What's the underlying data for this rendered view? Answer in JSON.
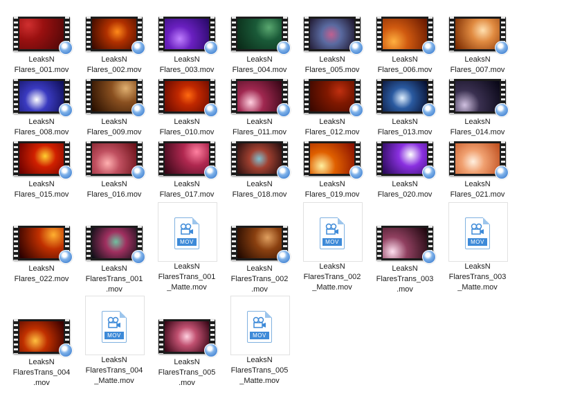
{
  "files": [
    {
      "line1": "LeaksN",
      "line2": "Flares_001.mov",
      "type": "video",
      "c1": "#d03030",
      "c2": "#500808",
      "c3": "#9a1010"
    },
    {
      "line1": "LeaksN",
      "line2": "Flares_002.mov",
      "type": "video",
      "c1": "#ff8a1a",
      "c2": "#3a0a00",
      "c3": "#b03000"
    },
    {
      "line1": "LeaksN",
      "line2": "Flares_003.mov",
      "type": "video",
      "c1": "#c080ff",
      "c2": "#2a0a6a",
      "c3": "#6a20c0"
    },
    {
      "line1": "LeaksN",
      "line2": "Flares_004.mov",
      "type": "video",
      "c1": "#5aa870",
      "c2": "#0a2a18",
      "c3": "#1a5a38"
    },
    {
      "line1": "LeaksN",
      "line2": "Flares_005.mov",
      "type": "video",
      "c1": "#c06090",
      "c2": "#201830",
      "c3": "#5a6aa0"
    },
    {
      "line1": "LeaksN",
      "line2": "Flares_006.mov",
      "type": "video",
      "c1": "#ffb040",
      "c2": "#6a1a00",
      "c3": "#d05a10"
    },
    {
      "line1": "LeaksN",
      "line2": "Flares_007.mov",
      "type": "video",
      "c1": "#ffe0b0",
      "c2": "#7a2a00",
      "c3": "#e08a40"
    },
    {
      "line1": "LeaksN",
      "line2": "Flares_008.mov",
      "type": "video",
      "c1": "#ffffff",
      "c2": "#10105a",
      "c3": "#3a3ac0"
    },
    {
      "line1": "LeaksN",
      "line2": "Flares_009.mov",
      "type": "video",
      "c1": "#e0b070",
      "c2": "#2a1000",
      "c3": "#8a5020"
    },
    {
      "line1": "LeaksN",
      "line2": "Flares_010.mov",
      "type": "video",
      "c1": "#ff6a10",
      "c2": "#6a0a00",
      "c3": "#c02800"
    },
    {
      "line1": "LeaksN",
      "line2": "Flares_011.mov",
      "type": "video",
      "c1": "#ffd0e0",
      "c2": "#3a0818",
      "c3": "#a02850"
    },
    {
      "line1": "LeaksN",
      "line2": "Flares_012.mov",
      "type": "video",
      "c1": "#c03010",
      "c2": "#3a0800",
      "c3": "#801800"
    },
    {
      "line1": "LeaksN",
      "line2": "Flares_013.mov",
      "type": "video",
      "c1": "#e0f0ff",
      "c2": "#081030",
      "c3": "#2a5aa0"
    },
    {
      "line1": "LeaksN",
      "line2": "Flares_014.mov",
      "type": "video",
      "c1": "#d0c0e0",
      "c2": "#0a0818",
      "c3": "#3a3050"
    },
    {
      "line1": "LeaksN",
      "line2": "Flares_015.mov",
      "type": "video",
      "c1": "#ffd030",
      "c2": "#6a0000",
      "c3": "#d02000"
    },
    {
      "line1": "LeaksN",
      "line2": "Flares_016.mov",
      "type": "video",
      "c1": "#ffb0b0",
      "c2": "#6a1018",
      "c3": "#c05060"
    },
    {
      "line1": "LeaksN",
      "line2": "Flares_017.mov",
      "type": "video",
      "c1": "#ff80a0",
      "c2": "#3a0818",
      "c3": "#b02850"
    },
    {
      "line1": "LeaksN",
      "line2": "Flares_018.mov",
      "type": "video",
      "c1": "#80c0d0",
      "c2": "#2a1010",
      "c3": "#a04030"
    },
    {
      "line1": "LeaksN",
      "line2": "Flares_019.mov",
      "type": "video",
      "c1": "#fff0a0",
      "c2": "#8a1000",
      "c3": "#e06000"
    },
    {
      "line1": "LeaksN",
      "line2": "Flares_020.mov",
      "type": "video",
      "c1": "#ffffff",
      "c2": "#2a0a5a",
      "c3": "#8a30e0"
    },
    {
      "line1": "LeaksN",
      "line2": "Flares_021.mov",
      "type": "video",
      "c1": "#fff0e0",
      "c2": "#c05020",
      "c3": "#f0a070"
    },
    {
      "line1": "LeaksN",
      "line2": "Flares_022.mov",
      "type": "video",
      "c1": "#ffb030",
      "c2": "#2a0000",
      "c3": "#c03000"
    },
    {
      "line1": "LeaksN",
      "line2": "FlaresTrans_001",
      "line3": ".mov",
      "type": "video",
      "c1": "#70c0a0",
      "c2": "#101018",
      "c3": "#a03060"
    },
    {
      "line1": "LeaksN",
      "line2": "FlaresTrans_001",
      "line3": "_Matte.mov",
      "type": "doc"
    },
    {
      "line1": "LeaksN",
      "line2": "FlaresTrans_002",
      "line3": ".mov",
      "type": "video",
      "c1": "#e0a060",
      "c2": "#200800",
      "c3": "#8a4010"
    },
    {
      "line1": "LeaksN",
      "line2": "FlaresTrans_002",
      "line3": "_Matte.mov",
      "type": "doc"
    },
    {
      "line1": "LeaksN",
      "line2": "FlaresTrans_003",
      "line3": ".mov",
      "type": "video",
      "c1": "#ffe0f0",
      "c2": "#200810",
      "c3": "#904060"
    },
    {
      "line1": "LeaksN",
      "line2": "FlaresTrans_003",
      "line3": "_Matte.mov",
      "type": "doc"
    },
    {
      "line1": "LeaksN",
      "line2": "FlaresTrans_004",
      "line3": ".mov",
      "type": "video",
      "c1": "#ffc040",
      "c2": "#3a0000",
      "c3": "#c03000"
    },
    {
      "line1": "LeaksN",
      "line2": "FlaresTrans_004",
      "line3": "_Matte.mov",
      "type": "doc"
    },
    {
      "line1": "LeaksN",
      "line2": "FlaresTrans_005",
      "line3": ".mov",
      "type": "video",
      "c1": "#ffd0e0",
      "c2": "#3a0818",
      "c3": "#c05070"
    },
    {
      "line1": "LeaksN",
      "line2": "FlaresTrans_005",
      "line3": "_Matte.mov",
      "type": "doc"
    }
  ],
  "doc_icon": {
    "ext_label": "MOV",
    "accent": "#3d8ad8"
  }
}
